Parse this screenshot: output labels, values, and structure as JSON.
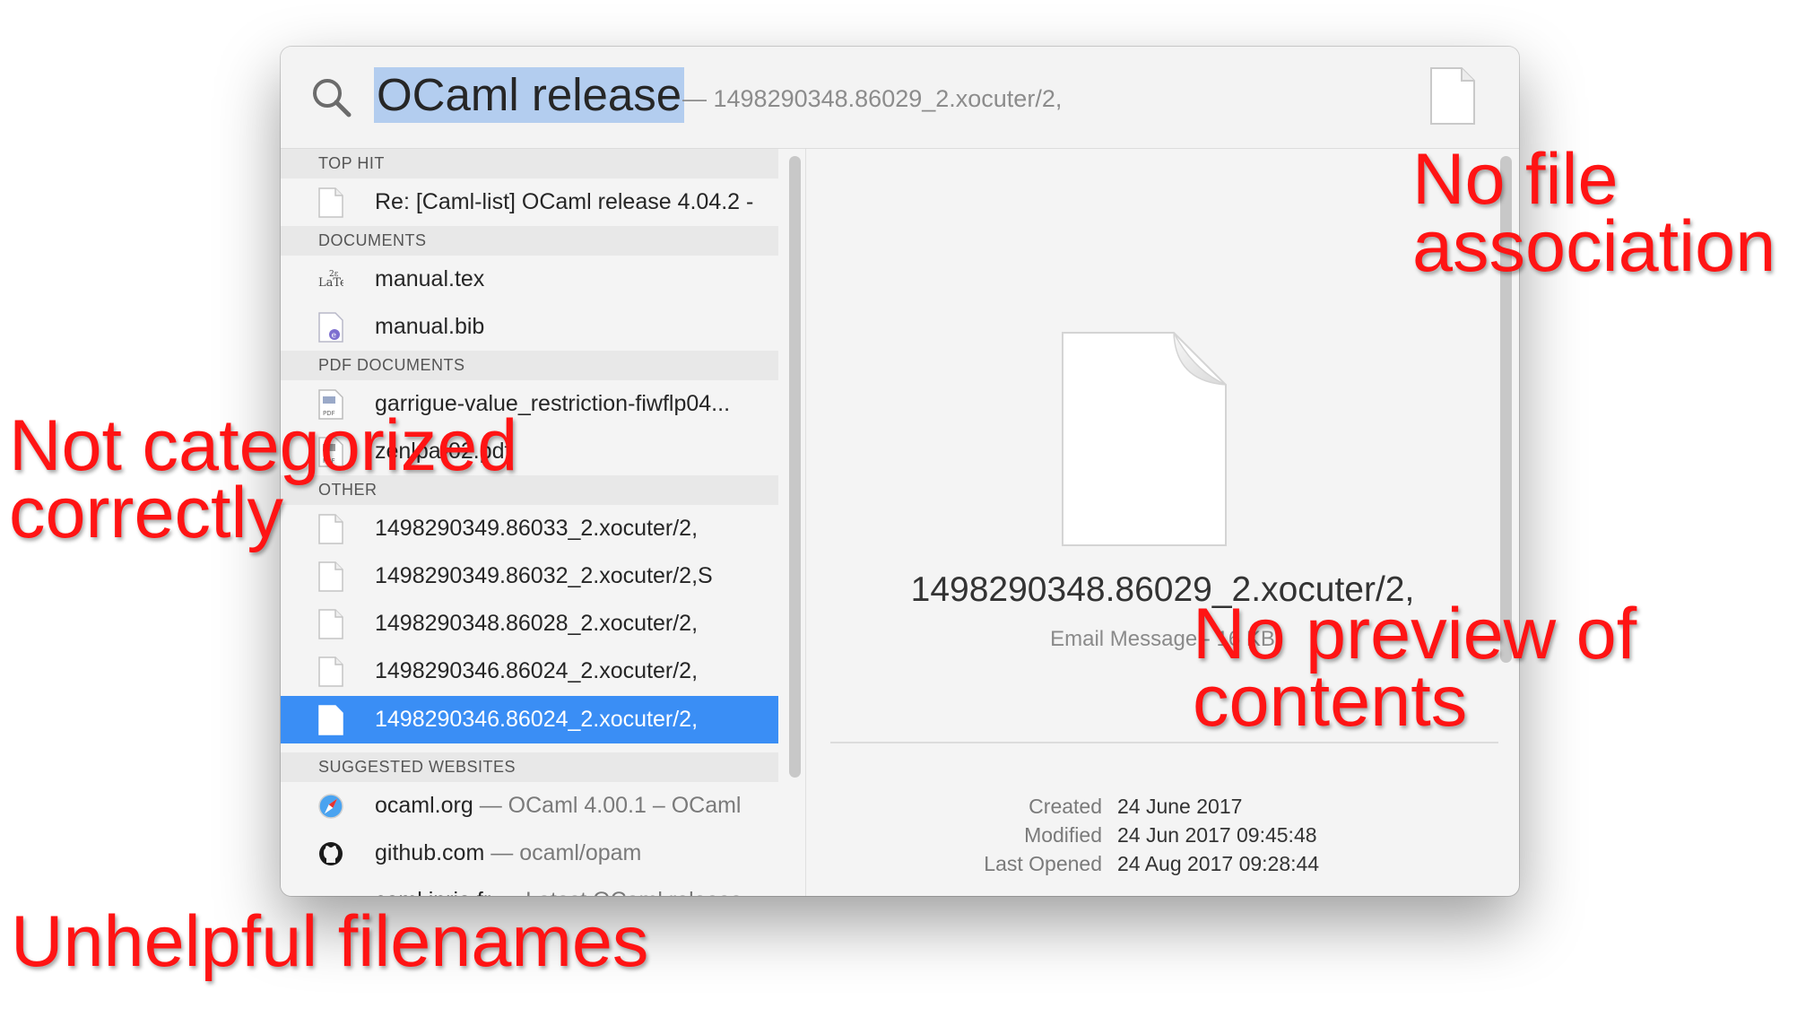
{
  "search": {
    "query": "OCaml release",
    "completion": "— 1498290348.86029_2.xocuter/2,"
  },
  "sections": {
    "top_hit": "TOP HIT",
    "documents": "DOCUMENTS",
    "pdf_documents": "PDF DOCUMENTS",
    "other": "OTHER",
    "suggested_websites": "SUGGESTED WEBSITES"
  },
  "results": {
    "top_hit": {
      "label": "Re: [Caml-list] OCaml release 4.04.2  -"
    },
    "documents": [
      {
        "label": "manual.tex",
        "icon": "latex-file-icon"
      },
      {
        "label": "manual.bib",
        "icon": "bibtex-file-icon"
      }
    ],
    "pdf_documents": [
      {
        "label": "garrigue-value_restriction-fiwflp04...",
        "icon": "pdf-file-icon"
      },
      {
        "label": "zenlpa-02.pdf",
        "icon": "pdf-file-icon"
      }
    ],
    "other": [
      {
        "label": "1498290349.86033_2.xocuter/2,"
      },
      {
        "label": "1498290349.86032_2.xocuter/2,S"
      },
      {
        "label": "1498290348.86028_2.xocuter/2,"
      },
      {
        "label": "1498290346.86024_2.xocuter/2,"
      },
      {
        "label": "1498290346.86024_2.xocuter/2,",
        "selected": true
      }
    ],
    "websites": [
      {
        "site": "ocaml.org",
        "desc": "— OCaml 4.00.1 – OCaml",
        "icon": "safari-compass-icon"
      },
      {
        "site": "github.com",
        "desc": "— ocaml/opam",
        "icon": "github-icon"
      },
      {
        "site": "caml.inria.fr",
        "desc": "— Latest OCaml release",
        "icon": "camel-icon"
      }
    ]
  },
  "preview": {
    "title": "1498290348.86029_2.xocuter/2,",
    "subtitle": "Email Message - 16 KB",
    "meta": {
      "created_label": "Created",
      "created_value": "24 June 2017",
      "modified_label": "Modified",
      "modified_value": "24 Jun 2017 09:45:48",
      "opened_label": "Last Opened",
      "opened_value": "24 Aug 2017 09:28:44"
    }
  },
  "annotations": {
    "no_file_line1": "No file",
    "no_file_line2": "association",
    "not_categorized_line1": "Not categorized",
    "not_categorized_line2": "correctly",
    "no_preview_line1": "No preview of",
    "no_preview_line2": "contents",
    "unhelpful": "Unhelpful filenames"
  },
  "colors": {
    "selection": "#3a8ef5",
    "query_highlight": "#b3cdef",
    "annotation": "#ff1414"
  }
}
